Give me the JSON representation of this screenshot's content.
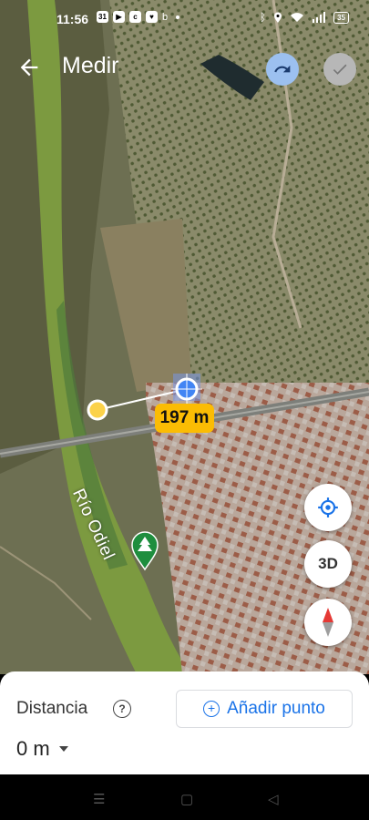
{
  "status_bar": {
    "time": "11:56",
    "calendar_badge": "31",
    "battery": "35"
  },
  "header": {
    "title": "Medir",
    "back_icon": "arrow-left-icon",
    "undo_icon": "undo-icon",
    "done_icon": "check-icon"
  },
  "map": {
    "river_label": "Río Odiel",
    "measure_label": "197 m",
    "colors": {
      "river": "#8aa64a",
      "measure_label_bg": "#fbbc04",
      "start_point": "#fbd24a",
      "end_point": "#4285f4"
    }
  },
  "map_controls": {
    "location_icon": "my-location-icon",
    "btn_3d": "3D",
    "compass_icon": "compass-icon"
  },
  "panel": {
    "distance_title": "Distancia",
    "help_icon_glyph": "?",
    "add_point_label": "Añadir punto",
    "distance_value": "0 m"
  },
  "nav_bar": {
    "menu_glyph": "☰",
    "home_glyph": "▢",
    "back_glyph": "◁"
  }
}
